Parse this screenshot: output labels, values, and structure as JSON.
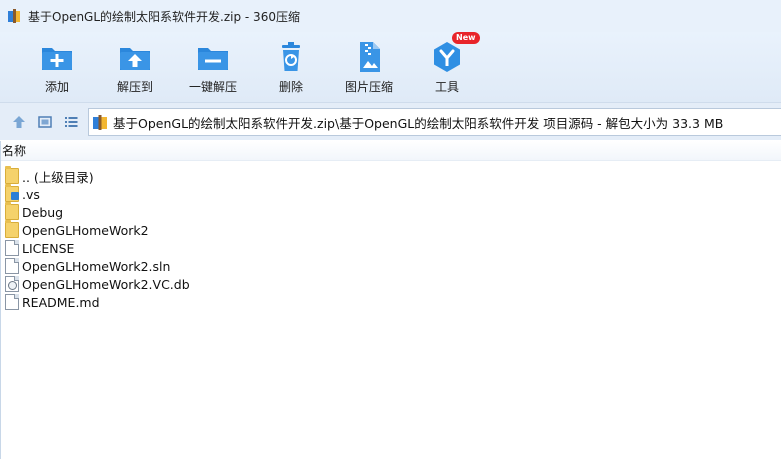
{
  "window": {
    "title": "基于OpenGL的绘制太阳系软件开发.zip - 360压缩"
  },
  "toolbar": {
    "items": [
      {
        "label": "添加",
        "icon": "add-folder-icon"
      },
      {
        "label": "解压到",
        "icon": "extract-to-icon"
      },
      {
        "label": "一键解压",
        "icon": "quick-extract-icon"
      },
      {
        "label": "删除",
        "icon": "delete-icon"
      },
      {
        "label": "图片压缩",
        "icon": "image-compress-icon"
      },
      {
        "label": "工具",
        "icon": "tools-icon",
        "badge": "New"
      }
    ]
  },
  "address_bar": {
    "path": "基于OpenGL的绘制太阳系软件开发.zip\\基于OpenGL的绘制太阳系软件开发 项目源码 - 解包大小为 33.3 MB"
  },
  "file_list": {
    "column_header": "名称",
    "rows": [
      {
        "name": ".. (上级目录)",
        "type": "folder"
      },
      {
        "name": ".vs",
        "type": "folder-vs"
      },
      {
        "name": "Debug",
        "type": "folder"
      },
      {
        "name": "OpenGLHomeWork2",
        "type": "folder"
      },
      {
        "name": "LICENSE",
        "type": "file"
      },
      {
        "name": "OpenGLHomeWork2.sln",
        "type": "file"
      },
      {
        "name": "OpenGLHomeWork2.VC.db",
        "type": "file-db"
      },
      {
        "name": "README.md",
        "type": "file"
      }
    ]
  },
  "colors": {
    "accent_blue": "#1e7fd6",
    "toolbar_bg": "#e4edf8",
    "badge_red": "#e8242a",
    "folder_yellow": "#f5d26b"
  }
}
